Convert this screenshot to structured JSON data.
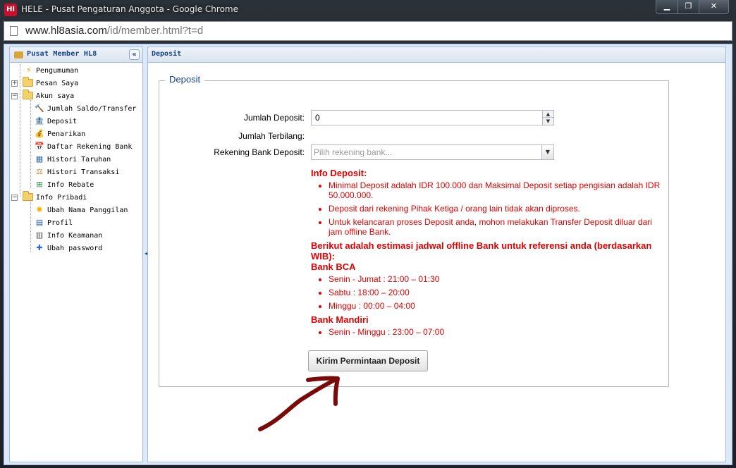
{
  "window": {
    "app_icon_text": "Hl",
    "title": "HELE - Pusat Pengaturan Anggota - Google Chrome",
    "controls": [
      "▁",
      "❐",
      "✕"
    ]
  },
  "addressbar": {
    "url_domain": "www.hl8asia.com",
    "url_path": "/id/member.html?t=d"
  },
  "sidebar": {
    "title": "Pusat Member HL8",
    "collapse_symbol": "«",
    "items": [
      {
        "label": "Pengumuman",
        "icon": "lightning-icon",
        "glyph": "⚡"
      },
      {
        "label": "Pesan Saya",
        "icon": "folder-icon"
      },
      {
        "label": "Akun saya",
        "icon": "folder-open-icon"
      },
      {
        "label": "Jumlah Saldo/Transfer",
        "icon": "gavel-icon",
        "glyph": "🔨"
      },
      {
        "label": "Deposit",
        "icon": "bank-icon",
        "glyph": "🏦"
      },
      {
        "label": "Penarikan",
        "icon": "moneybag-icon",
        "glyph": "💰"
      },
      {
        "label": "Daftar Rekening Bank",
        "icon": "calendar-icon",
        "glyph": "📅"
      },
      {
        "label": "Histori Taruhan",
        "icon": "table-icon",
        "glyph": "▦"
      },
      {
        "label": "Histori Transaksi",
        "icon": "scales-icon",
        "glyph": "⚖"
      },
      {
        "label": "Info Rebate",
        "icon": "network-icon",
        "glyph": "⊞"
      },
      {
        "label": "Info Pribadi",
        "icon": "folder-open-icon"
      },
      {
        "label": "Ubah Nama Panggilan",
        "icon": "sun-icon",
        "glyph": "✺"
      },
      {
        "label": "Profil",
        "icon": "profile-card-icon",
        "glyph": "▤"
      },
      {
        "label": "Info Keamanan",
        "icon": "security-list-icon",
        "glyph": "▥"
      },
      {
        "label": "Ubah password",
        "icon": "puzzle-icon",
        "glyph": "✚"
      }
    ]
  },
  "main": {
    "title": "Deposit",
    "fieldset_legend": "Deposit",
    "form": {
      "amount_label": "Jumlah Deposit:",
      "amount_value": "0",
      "amount_words_label": "Jumlah Terbilang:",
      "bank_label": "Rekening Bank Deposit:",
      "bank_placeholder": "Pilih rekening bank..."
    },
    "info": {
      "heading": "Info Deposit:",
      "bullets": [
        "Minimal Deposit adalah IDR 100.000 dan Maksimal Deposit setiap pengisian adalah IDR 50.000.000.",
        "Deposit dari rekening Pihak Ketiga / orang lain tidak akan diproses.",
        "Untuk kelancaran proses Deposit anda, mohon melakukan Transfer Deposit diluar dari jam offline Bank."
      ],
      "schedule_heading": "Berikut adalah estimasi jadwal offline Bank untuk referensi anda (berdasarkan WIB):",
      "banks": [
        {
          "name": "Bank BCA",
          "times": [
            "Senin - Jumat : 21:00 – 01:30",
            "Sabtu : 18:00 – 20:00",
            "Minggu : 00:00 – 04:00"
          ]
        },
        {
          "name": "Bank Mandiri",
          "times": [
            "Senin - Minggu : 23:00 – 07:00"
          ]
        }
      ]
    },
    "submit_label": "Kirim Permintaan Deposit"
  },
  "colors": {
    "header_text": "#15428b",
    "info_red": "#e00000",
    "annotation_arrow": "#7a0a0a"
  }
}
